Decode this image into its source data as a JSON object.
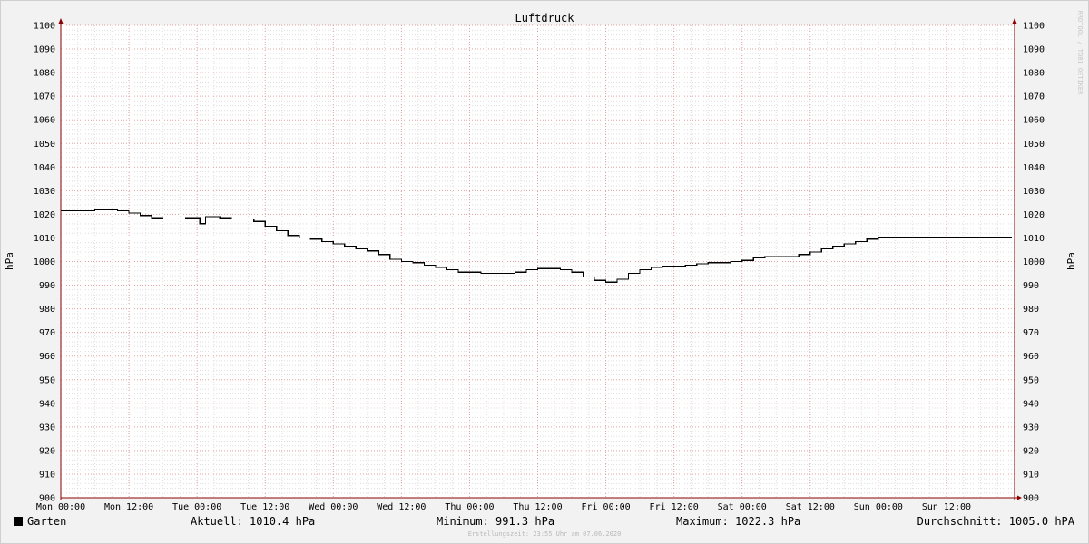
{
  "chart_data": {
    "type": "line",
    "title": "Luftdruck",
    "ylabel": "hPa",
    "xlabel": "",
    "ylim": [
      900,
      1100
    ],
    "y_ticks": [
      900,
      910,
      920,
      930,
      940,
      950,
      960,
      970,
      980,
      990,
      1000,
      1010,
      1020,
      1030,
      1040,
      1050,
      1060,
      1070,
      1080,
      1090,
      1100
    ],
    "x_ticks": [
      "Mon 00:00",
      "Mon 12:00",
      "Tue 00:00",
      "Tue 12:00",
      "Wed 00:00",
      "Wed 12:00",
      "Thu 00:00",
      "Thu 12:00",
      "Fri 00:00",
      "Fri 12:00",
      "Sat 00:00",
      "Sat 12:00",
      "Sun 00:00",
      "Sun 12:00"
    ],
    "x_unit": "hours since Mon 00:00",
    "grid": true,
    "series": [
      {
        "name": "Garten",
        "color": "#000000",
        "x": [
          0,
          4,
          6,
          8,
          10,
          12,
          14,
          16,
          18,
          20,
          22,
          24,
          24.5,
          25,
          25.5,
          26,
          28,
          30,
          32,
          34,
          36,
          38,
          40,
          42,
          44,
          46,
          48,
          50,
          52,
          54,
          56,
          58,
          60,
          62,
          64,
          66,
          68,
          70,
          72,
          74,
          76,
          78,
          80,
          82,
          84,
          86,
          88,
          90,
          92,
          94,
          96,
          98,
          100,
          102,
          104,
          106,
          108,
          110,
          112,
          114,
          116,
          118,
          120,
          122,
          124,
          126,
          128,
          130,
          132,
          134,
          136,
          138,
          140,
          142,
          144,
          146,
          148,
          150,
          152,
          154,
          156,
          158,
          160,
          162,
          164,
          166,
          167.5
        ],
        "values": [
          1021.5,
          1021.5,
          1022.0,
          1022.0,
          1021.5,
          1020.5,
          1019.5,
          1018.5,
          1018.0,
          1018.0,
          1018.5,
          1018.5,
          1016.0,
          1016.0,
          1019.0,
          1019.0,
          1018.5,
          1018.0,
          1018.0,
          1017.0,
          1015.0,
          1013.0,
          1011.0,
          1010.0,
          1009.5,
          1008.5,
          1007.5,
          1006.5,
          1005.5,
          1004.5,
          1003.0,
          1001.0,
          1000.0,
          999.5,
          998.5,
          997.5,
          996.5,
          995.5,
          995.5,
          995.0,
          995.0,
          995.0,
          995.5,
          996.5,
          997.0,
          997.0,
          996.5,
          995.5,
          993.5,
          992.0,
          991.3,
          992.5,
          995.0,
          996.5,
          997.5,
          998.0,
          998.0,
          998.5,
          999.0,
          999.5,
          999.5,
          1000.0,
          1000.5,
          1001.5,
          1002.0,
          1002.0,
          1002.0,
          1003.0,
          1004.0,
          1005.5,
          1006.5,
          1007.5,
          1008.5,
          1009.5,
          1010.4,
          1010.4,
          1010.4,
          1010.4,
          1010.4,
          1010.4,
          1010.4,
          1010.4,
          1010.4,
          1010.4,
          1010.4,
          1010.4,
          1010.4
        ]
      }
    ]
  },
  "legend": {
    "series_label": "Garten",
    "current": "Aktuell: 1010.4 hPa",
    "minimum": "Minimum: 991.3 hPa",
    "maximum": "Maximum: 1022.3 hPa",
    "average": "Durchschnitt: 1005.0 hPA"
  },
  "footer": "Erstellungszeit: 23:55 Uhr am 07.06.2020",
  "watermark": "RRDTOOL / TOBI OETIKER",
  "colors": {
    "background": "#f2f2f2",
    "plot_background": "#ffffff",
    "major_grid": "#e3a0a0",
    "minor_grid": "#dedede",
    "axis_arrow": "#8b0000",
    "line": "#000000"
  }
}
